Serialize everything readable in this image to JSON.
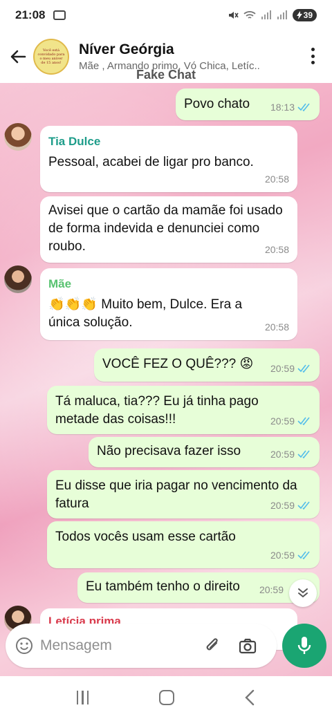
{
  "status_bar": {
    "time": "21:08",
    "battery": "39"
  },
  "header": {
    "title": "Níver Geórgia",
    "subtitle": "Mãe , Armando primo, Vó Chica, Letíc..",
    "overlay_label": "Fake Chat",
    "avatar_text": "Você está convidado para o meu aniver de 15 anos!"
  },
  "messages": [
    {
      "type": "out",
      "text": "Povo chato",
      "time": "18:13",
      "read": true
    },
    {
      "type": "in",
      "sender": "Tia Dulce",
      "sender_color": "#1e9d8a",
      "text": "Pessoal, acabei de ligar pro banco.",
      "time": "20:58"
    },
    {
      "type": "in",
      "text": "Avisei que o cartão da mamãe foi usado de forma indevida e denunciei como roubo.",
      "time": "20:58"
    },
    {
      "type": "in",
      "sender": "Mãe",
      "sender_color": "#58c270",
      "text": "👏👏👏 Muito bem, Dulce. Era a única solução.",
      "time": "20:58"
    },
    {
      "type": "out",
      "text": "VOCÊ FEZ O QUÊ??? 😡",
      "time": "20:59",
      "read": true
    },
    {
      "type": "out",
      "text": "Tá maluca, tia??? Eu já tinha pago metade das coisas!!!",
      "time": "20:59",
      "read": true
    },
    {
      "type": "out",
      "text": "Não precisava fazer isso",
      "time": "20:59",
      "read": true
    },
    {
      "type": "out",
      "text": "Eu disse que iria pagar no vencimento da fatura",
      "time": "20:59",
      "read": true
    },
    {
      "type": "out",
      "text": "Todos vocês usam esse cartão",
      "time": "20:59",
      "read": true
    },
    {
      "type": "out",
      "text": "Eu também tenho o direito",
      "time": "20:59",
      "read": true
    },
    {
      "type": "in",
      "sender": "Letícia prima",
      "sender_color": "#d93a4c",
      "text": "",
      "time": ""
    }
  ],
  "input": {
    "placeholder": "Mensagem"
  },
  "colors": {
    "accent": "#1aa572",
    "outgoing_bubble": "#e7fed8",
    "tick_blue": "#53bdeb"
  }
}
